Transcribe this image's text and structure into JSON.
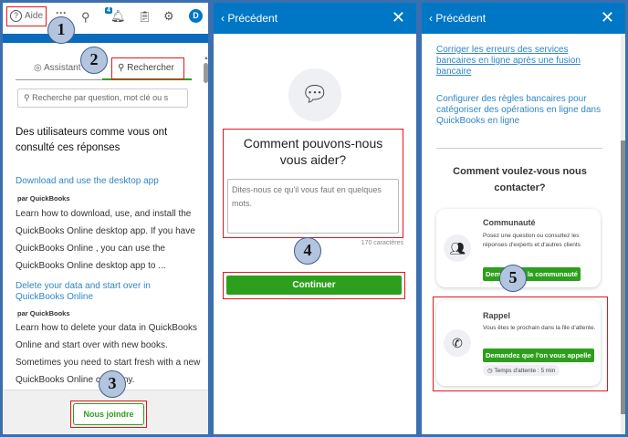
{
  "panel1": {
    "help_label": "Aide",
    "notif_count": "4",
    "avatar": "D",
    "tab_assistant": "Assistant",
    "tab_search": "Rechercher",
    "search_placeholder": "Recherche par question, mot clé ou s",
    "heading": "Des utilisateurs comme vous ont consulté ces réponses",
    "articles": [
      {
        "title": "Download and use the desktop app",
        "by": "par QuickBooks",
        "text": "Learn how to download, use, and install the QuickBooks Online desktop app. If you have QuickBooks Online , you can use the QuickBooks Online desktop app to ..."
      },
      {
        "title": "Delete your data and start over in QuickBooks Online",
        "by": "par QuickBooks",
        "text": "Learn how to delete your data in QuickBooks Online and start over with new books. Sometimes you need to start fresh with a new QuickBooks Online company."
      }
    ],
    "contact_button": "Nous joindre"
  },
  "panel2": {
    "back": "‹ Précédent",
    "close": "✕",
    "heading": "Comment pouvons-nous vous aider?",
    "placeholder": "Dites-nous ce qu'il vous faut en quelques mots.",
    "char_count": "170 caractères",
    "continue": "Continuer"
  },
  "panel3": {
    "back": "‹ Précédent",
    "close": "✕",
    "link1": "Corriger les erreurs des services bancaires en ligne après une fusion bancaire",
    "link2": "Configurer des règles bancaires pour catégoriser des opérations en ligne dans QuickBooks en ligne",
    "heading": "Comment voulez-vous nous contacter?",
    "community": {
      "title": "Communauté",
      "text": "Posez une question ou consultez les réponses d'experts et d'autres clients",
      "button": "Demandez à la communauté"
    },
    "callback": {
      "title": "Rappel",
      "text": "Vous êtes le prochain dans la file d'attente.",
      "button": "Demandez que l'on vous appelle",
      "wait": "Temps d'attente : 5 min"
    }
  },
  "badges": [
    "1",
    "2",
    "3",
    "4",
    "5"
  ]
}
